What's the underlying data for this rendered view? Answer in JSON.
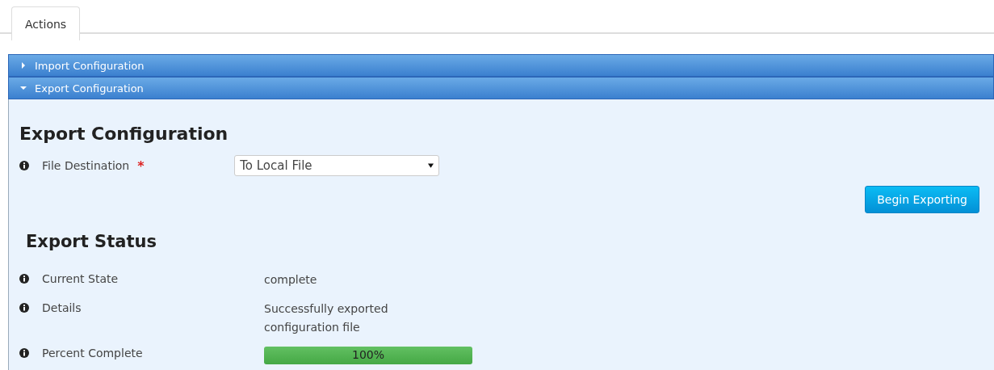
{
  "tabs": [
    {
      "label": "Actions",
      "selected": true
    }
  ],
  "sections": [
    {
      "title": "Import Configuration",
      "expanded": false
    },
    {
      "title": "Export Configuration",
      "expanded": true
    }
  ],
  "export": {
    "heading": "Export Configuration",
    "field": {
      "label": "File Destination",
      "required_mark": "*",
      "value": "To Local File"
    },
    "button": "Begin Exporting"
  },
  "status": {
    "heading": "Export Status",
    "rows": [
      {
        "kind": "text",
        "label": "Current State",
        "value": "complete"
      },
      {
        "kind": "text",
        "label": "Details",
        "value": "Successfully exported configuration file"
      },
      {
        "kind": "progress",
        "label": "Percent Complete",
        "level": 1,
        "value": "100%"
      }
    ]
  }
}
